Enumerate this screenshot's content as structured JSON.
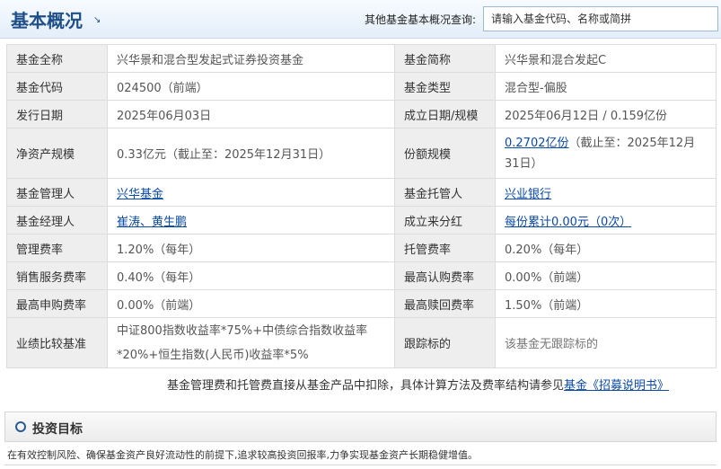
{
  "header": {
    "title": "基本概况",
    "title_arrow": "↘",
    "search_label": "其他基金基本概况查询:",
    "search_placeholder": "请输入基金代码、名称或简拼"
  },
  "info": {
    "full_name_label": "基金全称",
    "full_name": "兴华景和混合型发起式证券投资基金",
    "short_name_label": "基金简称",
    "short_name": "兴华景和混合发起C",
    "code_label": "基金代码",
    "code": "024500（前端）",
    "type_label": "基金类型",
    "type": "混合型-偏股",
    "issue_date_label": "发行日期",
    "issue_date": "2025年06月03日",
    "establish_label": "成立日期/规模",
    "establish": "2025年06月12日 / 0.159亿份",
    "net_asset_label": "净资产规模",
    "net_asset": "0.33亿元（截止至：2025年12月31日）",
    "share_label": "份额规模",
    "share_link": "0.2702亿份",
    "share_rest": "（截止至：2025年12月31日）",
    "manager_co_label": "基金管理人",
    "manager_co": "兴华基金",
    "custodian_label": "基金托管人",
    "custodian": "兴业银行",
    "managers_label": "基金经理人",
    "manager_1": "崔涛",
    "managers_sep": "、",
    "manager_2": "黄生鹏",
    "dividend_label": "成立来分红",
    "dividend": "每份累计0.00元（0次）",
    "mgmt_fee_label": "管理费率",
    "mgmt_fee": "1.20%（每年）",
    "custody_fee_label": "托管费率",
    "custody_fee": "0.20%（每年）",
    "sales_fee_label": "销售服务费率",
    "sales_fee": "0.40%（每年）",
    "max_sub_label": "最高认购费率",
    "max_sub": "0.00%（前端）",
    "max_purchase_label": "最高申购费率",
    "max_purchase": "0.00%（前端）",
    "max_redeem_label": "最高赎回费率",
    "max_redeem": "1.50%（前端）",
    "benchmark_label": "业绩比较基准",
    "benchmark": "中证800指数收益率*75%+中债综合指数收益率*20%+恒生指数(人民币)收益率*5%",
    "tracking_label": "跟踪标的",
    "tracking": "该基金无跟踪标的"
  },
  "note": {
    "text": "基金管理费和托管费直接从基金产品中扣除，具体计算方法及费率结构请参见",
    "link": "基金《招募说明书》"
  },
  "invest_target": {
    "title": "投资目标",
    "text": "在有效控制风险、确保基金资产良好流动性的前提下,追求较高投资回报率,力争实现基金资产长期稳健增值。"
  },
  "colors": {
    "title": "#1f4f88",
    "link": "#0b4aa6",
    "label_bg": "#eeeeee"
  }
}
